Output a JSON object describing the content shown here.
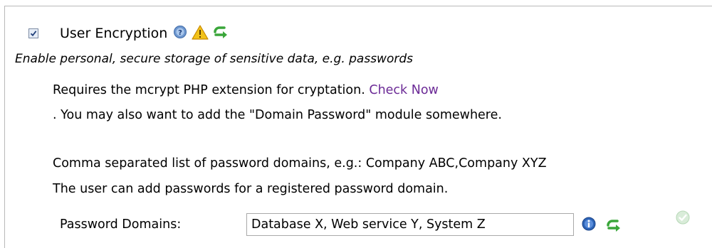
{
  "module": {
    "title": "User Encryption",
    "checked": true,
    "description": "Enable personal, secure storage of sensitive data, e.g. passwords",
    "requirement_text": "Requires the mcrypt PHP extension for cryptation.",
    "check_now_link": "Check Now",
    "domain_hint": ". You may also want to add the \"Domain Password\" module somewhere.",
    "comma_hint": "Comma separated list of password domains, e.g.: Company ABC,Company XYZ",
    "user_hint": "The user can add passwords for a registered password domain."
  },
  "password_domains": {
    "label": "Password Domains:",
    "value": "Database X, Web service Y, System Z"
  },
  "icons": {
    "help": "help-icon",
    "warning": "warning-icon",
    "reset": "reset-icon",
    "info": "info-icon",
    "ok": "checkmark-icon"
  },
  "colors": {
    "link": "#6b2a96",
    "reset_green": "#3aa63a",
    "info_blue": "#2d64b7",
    "warning_yellow": "#f2c21a"
  }
}
